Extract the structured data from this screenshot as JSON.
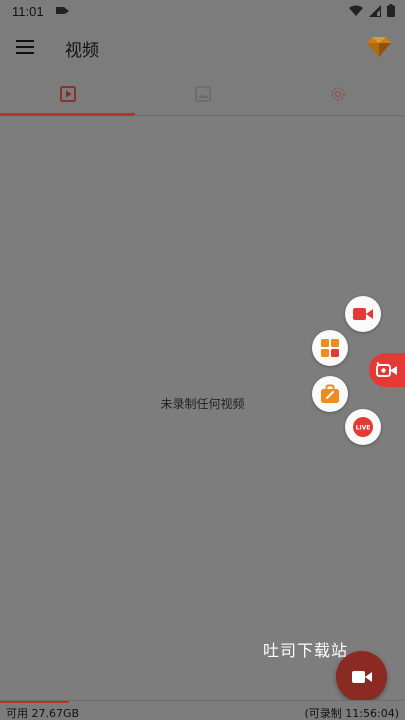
{
  "status_bar": {
    "time": "11:01"
  },
  "app_bar": {
    "title": "视频"
  },
  "tabs": [
    {
      "name": "videos",
      "icon": "play-box-icon",
      "active": true
    },
    {
      "name": "images",
      "icon": "image-icon",
      "active": false
    },
    {
      "name": "settings",
      "icon": "gear-icon",
      "active": false
    }
  ],
  "content": {
    "empty_message": "未录制任何视频"
  },
  "floating_menu": {
    "items": [
      "video-camera-icon",
      "grid-apps-icon",
      "toolbox-icon",
      "live-icon"
    ],
    "handle_icon": "floating-camera-icon"
  },
  "watermark": "吐司下载站",
  "bottom_bar": {
    "available": "可用 27.67GB",
    "remaining": "(可录制 11:56:04)",
    "storage_used_fraction": 0.17
  },
  "colors": {
    "accent": "#b5352b",
    "red": "#e53935",
    "overlay_bg": "#7d7d7d"
  }
}
